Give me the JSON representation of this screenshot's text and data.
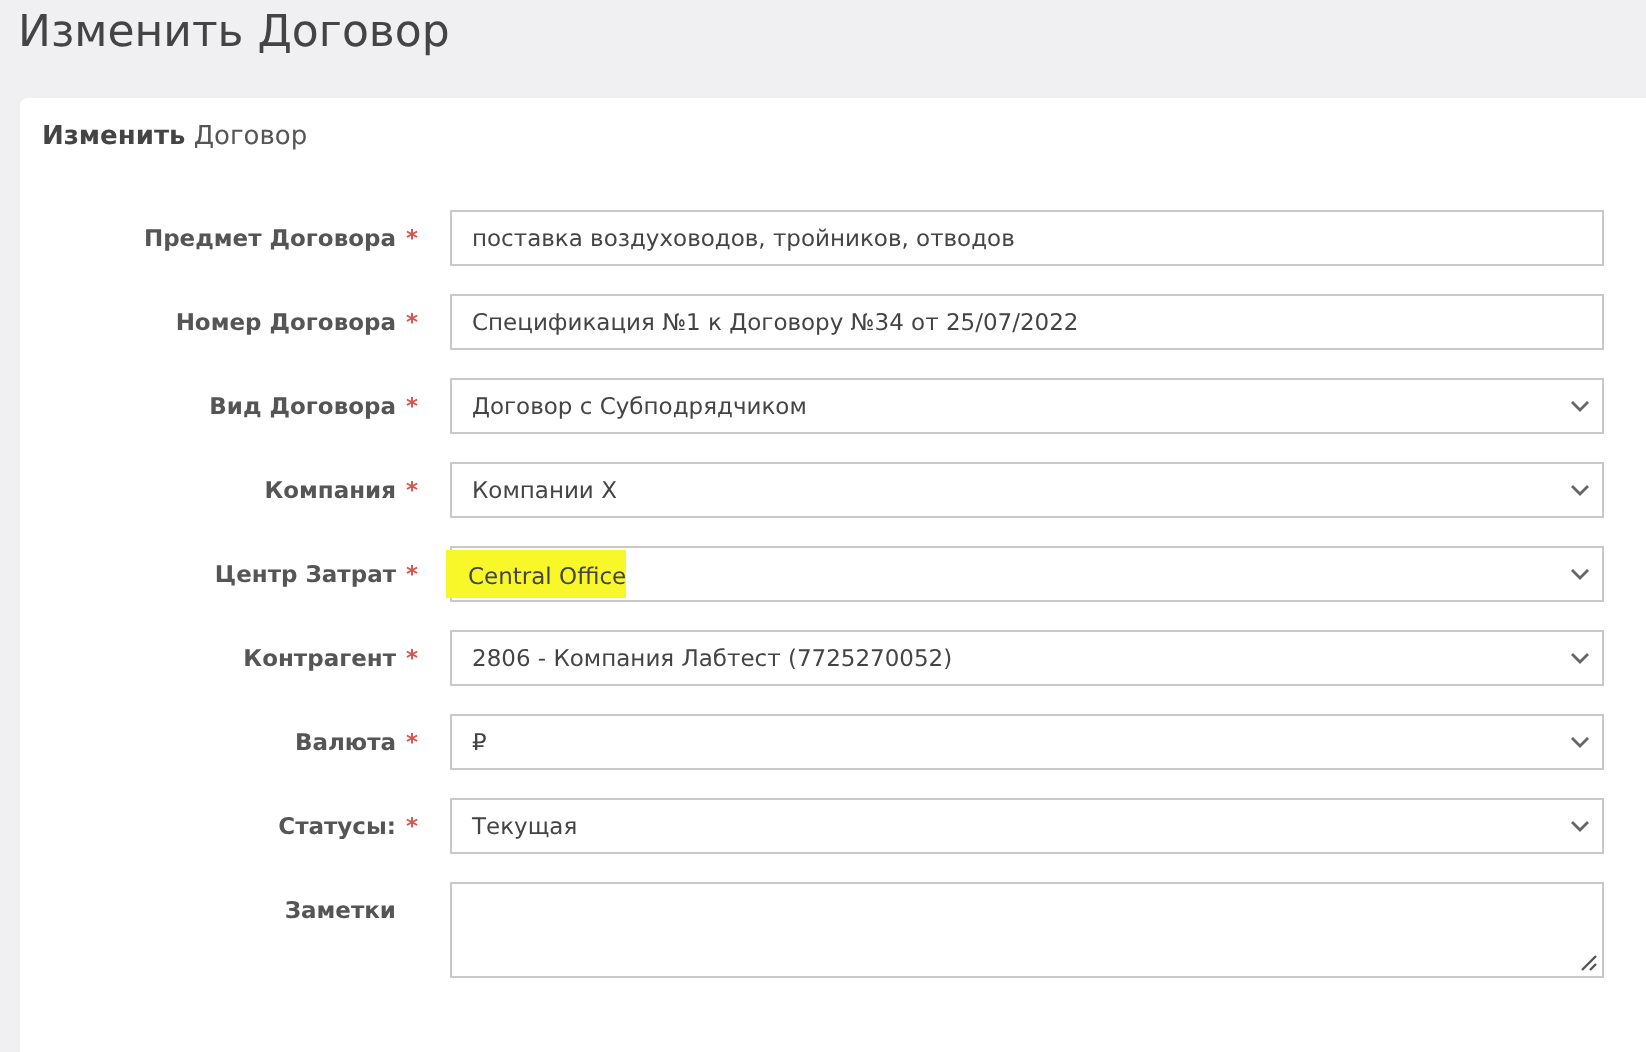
{
  "page_title": "Изменить Договор",
  "card": {
    "title": "**Изменить** Договор"
  },
  "fields": [
    {
      "label": "Предмет Договора",
      "required_mark": "*",
      "kind": "text",
      "value": "поставка воздуховодов, тройников, отводов"
    },
    {
      "label": "Номер Договора",
      "required_mark": "*",
      "kind": "text",
      "value": "Спецификация №1 к Договору №34 от 25/07/2022"
    },
    {
      "label": "Вид Договора",
      "required_mark": "*",
      "kind": "select",
      "value": "Договор с Субподрядчиком"
    },
    {
      "label": "Компания",
      "required_mark": "*",
      "kind": "select",
      "value": "Компании X"
    },
    {
      "label": "Центр Затрат",
      "required_mark": "*",
      "kind": "select",
      "value": "Central Office",
      "highlighted": true
    },
    {
      "label": "Контрагент",
      "required_mark": "*",
      "kind": "select",
      "value": "2806 - Компания Лабтест (7725270052)"
    },
    {
      "label": "Валюта",
      "required_mark": "*",
      "kind": "select",
      "value": "₽"
    },
    {
      "label": "Статусы:",
      "required_mark": "*",
      "kind": "select",
      "value": "Текущая"
    },
    {
      "label": "Заметки",
      "kind": "textarea"
    }
  ]
}
